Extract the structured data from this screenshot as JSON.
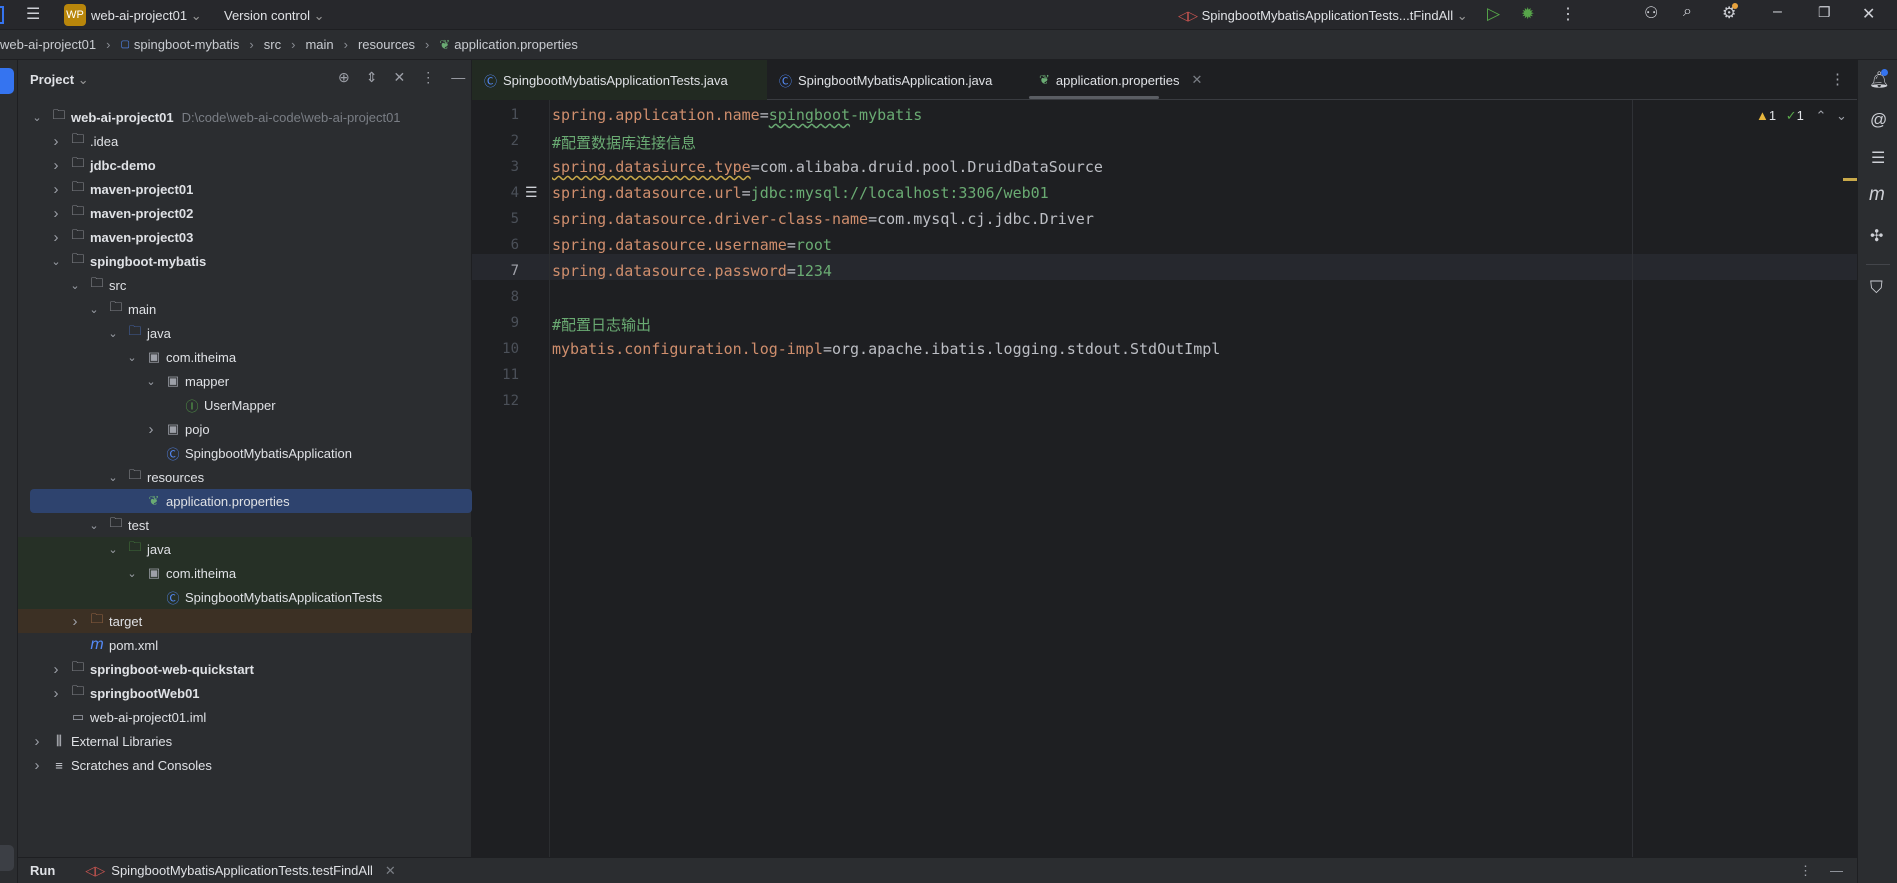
{
  "titlebar": {
    "logo": "WP",
    "project": "web-ai-project01",
    "vcs": "Version control",
    "run_config": "SpingbootMybatisApplicationTests...tFindAll"
  },
  "breadcrumb": [
    "web-ai-project01",
    "spingboot-mybatis",
    "src",
    "main",
    "resources",
    "application.properties"
  ],
  "project_panel": {
    "title": "Project",
    "rows": [
      {
        "level": 0,
        "chev": "down",
        "icon": "module-folder",
        "name": "web-ai-project01",
        "bold": true,
        "hint": "D:\\code\\web-ai-code\\web-ai-project01"
      },
      {
        "level": 1,
        "chev": "right",
        "icon": "folder",
        "name": ".idea"
      },
      {
        "level": 1,
        "chev": "right",
        "icon": "module-folder",
        "name": "jdbc-demo",
        "bold": true
      },
      {
        "level": 1,
        "chev": "right",
        "icon": "module-folder",
        "name": "maven-project01",
        "bold": true
      },
      {
        "level": 1,
        "chev": "right",
        "icon": "module-folder",
        "name": "maven-project02",
        "bold": true
      },
      {
        "level": 1,
        "chev": "right",
        "icon": "module-folder",
        "name": "maven-project03",
        "bold": true
      },
      {
        "level": 1,
        "chev": "down",
        "icon": "module-folder",
        "name": "spingboot-mybatis",
        "bold": true
      },
      {
        "level": 2,
        "chev": "down",
        "icon": "folder",
        "name": "src"
      },
      {
        "level": 3,
        "chev": "down",
        "icon": "folder",
        "name": "main"
      },
      {
        "level": 4,
        "chev": "down",
        "icon": "source-folder",
        "name": "java"
      },
      {
        "level": 5,
        "chev": "down",
        "icon": "package",
        "name": "com.itheima"
      },
      {
        "level": 6,
        "chev": "down",
        "icon": "package",
        "name": "mapper"
      },
      {
        "level": 7,
        "chev": "none",
        "icon": "interface",
        "name": "UserMapper"
      },
      {
        "level": 6,
        "chev": "right",
        "icon": "package",
        "name": "pojo"
      },
      {
        "level": 6,
        "chev": "none",
        "icon": "spring-class",
        "name": "SpingbootMybatisApplication"
      },
      {
        "level": 4,
        "chev": "down",
        "icon": "resources-folder",
        "name": "resources"
      },
      {
        "level": 5,
        "chev": "none",
        "icon": "spring-properties",
        "name": "application.properties",
        "selected": true
      },
      {
        "level": 3,
        "chev": "down",
        "icon": "folder",
        "name": "test"
      },
      {
        "level": 4,
        "chev": "down",
        "icon": "test-folder",
        "name": "java",
        "bg": "test"
      },
      {
        "level": 5,
        "chev": "down",
        "icon": "package",
        "name": "com.itheima",
        "bg": "test"
      },
      {
        "level": 6,
        "chev": "none",
        "icon": "test-class",
        "name": "SpingbootMybatisApplicationTests",
        "bg": "test"
      },
      {
        "level": 2,
        "chev": "right",
        "icon": "excluded-folder",
        "name": "target",
        "bg": "excluded"
      },
      {
        "level": 2,
        "chev": "none",
        "icon": "maven",
        "name": "pom.xml"
      },
      {
        "level": 1,
        "chev": "right",
        "icon": "module-folder",
        "name": "springboot-web-quickstart",
        "bold": true
      },
      {
        "level": 1,
        "chev": "right",
        "icon": "module-folder",
        "name": "springbootWeb01",
        "bold": true
      },
      {
        "level": 1,
        "chev": "none",
        "icon": "iml-file",
        "name": "web-ai-project01.iml"
      },
      {
        "level": 0,
        "chev": "right",
        "icon": "libraries",
        "name": "External Libraries"
      },
      {
        "level": 0,
        "chev": "right",
        "icon": "scratches",
        "name": "Scratches and Consoles"
      }
    ]
  },
  "tabs": [
    {
      "label": "SpingbootMybatisApplicationTests.java",
      "icon": "test-class"
    },
    {
      "label": "SpingbootMybatisApplication.java",
      "icon": "spring-class"
    },
    {
      "label": "application.properties",
      "icon": "spring-properties",
      "active": true
    }
  ],
  "inspections": {
    "warnings": "1",
    "typos": "1"
  },
  "code_lines": [
    [
      {
        "t": "spring.application.name",
        "c": "k"
      },
      {
        "t": "=",
        "c": "p"
      },
      {
        "t": "spingboot",
        "c": "v squig"
      },
      {
        "t": "-mybatis",
        "c": "v"
      }
    ],
    [
      {
        "t": "#配置数据库连接信息",
        "c": "c"
      }
    ],
    [
      {
        "t": "spring.datasiurce.type",
        "c": "k squigy"
      },
      {
        "t": "=",
        "c": "p"
      },
      {
        "t": "com.alibaba.druid.pool.DruidDataSource",
        "c": "p"
      }
    ],
    [
      {
        "t": "spring.datasource.url",
        "c": "k"
      },
      {
        "t": "=",
        "c": "p"
      },
      {
        "t": "jdbc:mysql://localhost:3306/web01",
        "c": "v"
      }
    ],
    [
      {
        "t": "spring.datasource.driver-class-name",
        "c": "k"
      },
      {
        "t": "=",
        "c": "p"
      },
      {
        "t": "com.mysql.cj.jdbc.Driver",
        "c": "p"
      }
    ],
    [
      {
        "t": "spring.datasource.username",
        "c": "k"
      },
      {
        "t": "=",
        "c": "p"
      },
      {
        "t": "root",
        "c": "v"
      }
    ],
    [
      {
        "t": "spring.datasource.password",
        "c": "k"
      },
      {
        "t": "=",
        "c": "p"
      },
      {
        "t": "1234",
        "c": "v"
      }
    ],
    [],
    [
      {
        "t": "#配置日志输出",
        "c": "c"
      }
    ],
    [
      {
        "t": "mybatis.configuration.log-impl",
        "c": "k"
      },
      {
        "t": "=",
        "c": "p"
      },
      {
        "t": "org.apache.ibatis.logging.stdout.StdOutImpl",
        "c": "p"
      }
    ],
    [],
    []
  ],
  "current_line": 7,
  "run_panel": {
    "title": "Run",
    "tab": "SpingbootMybatisApplicationTests.testFindAll"
  },
  "right_tools": [
    "notifications-icon",
    "ai-assistant-icon",
    "database-icon",
    "maven-icon",
    "plugin-icon",
    "security-icon"
  ]
}
